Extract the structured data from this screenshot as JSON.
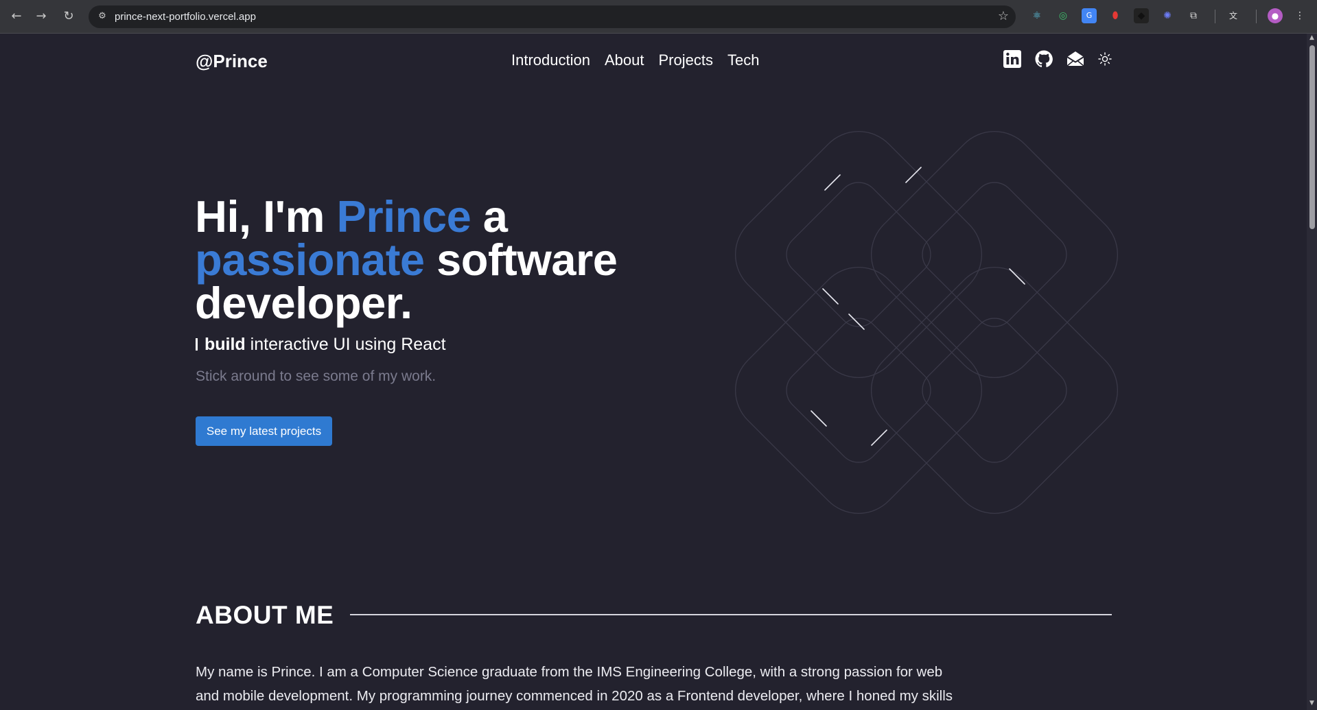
{
  "browser": {
    "back_icon": "arrow-left-icon",
    "forward_icon": "arrow-right-icon",
    "reload_icon": "reload-icon",
    "site_info_icon": "site-info-icon",
    "url": "prince-next-portfolio.vercel.app",
    "bookmark_icon": "star-icon",
    "extensions": [
      "react-devtools-icon",
      "circle-extension-icon",
      "google-translate-icon",
      "red-extension-icon",
      "dark-extension-icon",
      "blue-extension-icon",
      "puzzle-icon",
      "translate-icon",
      "profile-avatar-icon",
      "menu-icon"
    ]
  },
  "header": {
    "brand": "@Prince",
    "nav": [
      "Introduction",
      "About",
      "Projects",
      "Tech"
    ],
    "socials": [
      "linkedin-icon",
      "github-icon",
      "mail-icon",
      "sun-icon"
    ]
  },
  "hero": {
    "title_part1": "Hi, I'm ",
    "title_accent1": "Prince",
    "title_part2": " a",
    "title_accent2": "passionate",
    "title_part3": " software developer.",
    "sub_bold": "build",
    "sub_rest": " interactive UI using React",
    "tagline": "Stick around to see some of my work.",
    "cta": "See my latest projects"
  },
  "about": {
    "title": "ABOUT ME",
    "text": "My name is Prince. I am a Computer Science graduate from the IMS Engineering College, with a strong passion for web and mobile development. My programming journey commenced in 2020 as a Frontend developer, where I honed my skills"
  },
  "colors": {
    "background": "#23222e",
    "accent": "#3a7bd5",
    "button": "#2f7ad1",
    "muted_text": "#7b7b8e"
  }
}
